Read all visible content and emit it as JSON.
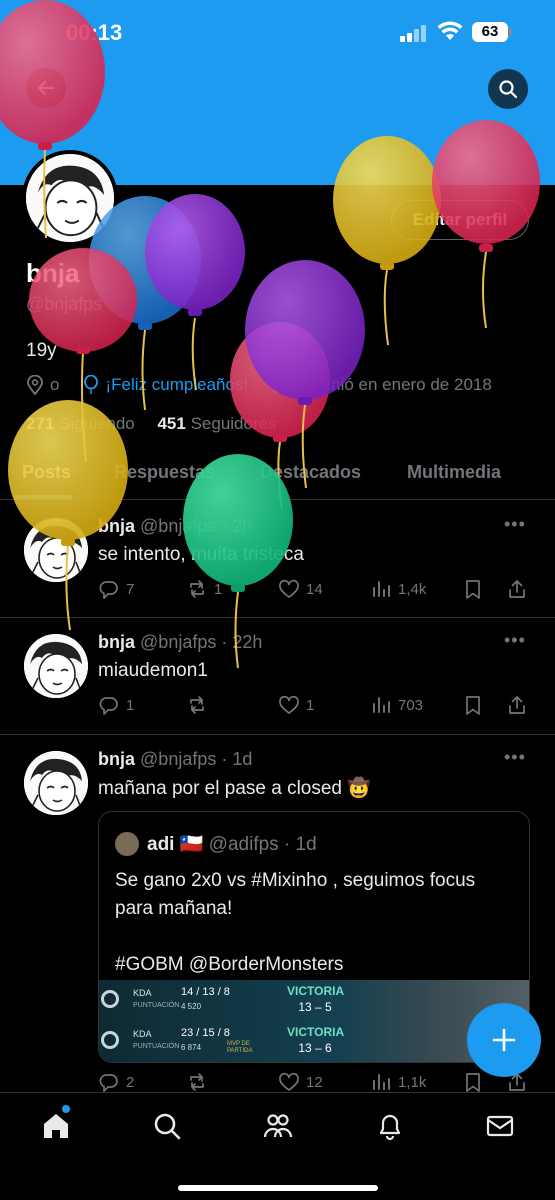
{
  "status_bar": {
    "time": "00:13",
    "battery": "63"
  },
  "profile": {
    "name": "bnja",
    "handle": "@bnjafps",
    "bio": "19y",
    "location": "o",
    "birthday": "¡Feliz cumpleaños!",
    "joined": "Se unió en enero de 2018",
    "following_count": "271",
    "following_label": "Siguiendo",
    "followers_count": "451",
    "followers_label": "Seguidores",
    "edit_label": "Editar perfil"
  },
  "tabs": [
    "Posts",
    "Respuestas",
    "Destacados",
    "Multimedia"
  ],
  "posts": [
    {
      "name": "bnja",
      "handle": "@bnjafps",
      "time": "· 2h",
      "text": "se intento, muita tristeca",
      "replies": "7",
      "reposts": "1",
      "likes": "14",
      "views": "1,4k"
    },
    {
      "name": "bnja",
      "handle": "@bnjafps",
      "time": "· 22h",
      "text": "miaudemon1",
      "replies": "1",
      "reposts": "",
      "likes": "1",
      "views": "703"
    },
    {
      "name": "bnja",
      "handle": "@bnjafps",
      "time": "· 1d",
      "text": "mañana por el pase a closed 🤠",
      "replies": "2",
      "reposts": "",
      "likes": "12",
      "views": "1,1k",
      "quote": {
        "name": "adi 🇨🇱",
        "handle": "@adifps",
        "time": "· 1d",
        "text": "Se gano 2x0 vs #Mixinho , seguimos focus para mañana!\n\n#GOBM @BorderMonsters",
        "media": [
          {
            "kda_label": "KDA",
            "kda": "14 / 13 / 8",
            "pts_label": "PUNTUACIÓN",
            "pts": "4 520",
            "mvp": "",
            "result": "VICTORIA",
            "score": "13 – 5"
          },
          {
            "kda_label": "KDA",
            "kda": "23 / 15 / 8",
            "pts_label": "PUNTUACIÓN",
            "pts": "6 874",
            "mvp": "MVP DE PARTIDA",
            "result": "VICTORIA",
            "score": "13 – 6"
          }
        ]
      }
    }
  ],
  "icons": {
    "back": "arrow-left-icon",
    "search": "search-icon",
    "location": "location-pin-icon",
    "birthday": "balloon-icon",
    "calendar": "calendar-icon",
    "reply": "reply-icon",
    "repost": "repost-icon",
    "like": "heart-icon",
    "views": "views-icon",
    "bookmark": "bookmark-icon",
    "share": "share-icon",
    "compose": "plus-icon",
    "nav_home": "home-icon",
    "nav_search": "search-icon",
    "nav_communities": "communities-icon",
    "nav_notifications": "bell-icon",
    "nav_messages": "mail-icon"
  },
  "colors": {
    "accent": "#1d9bf0",
    "background": "#000000",
    "muted": "#71767b",
    "text": "#e7e9ea"
  }
}
